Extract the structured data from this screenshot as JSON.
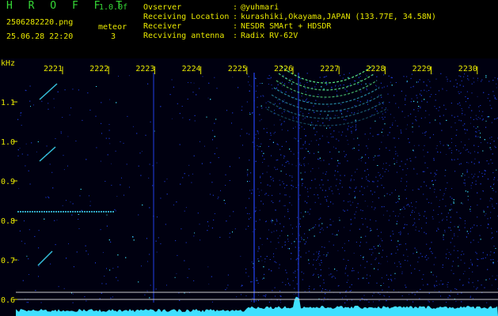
{
  "app": {
    "title": "H R O F F T",
    "version": "1.0.0f",
    "filename": "2506282220.png",
    "datetime": "25.06.28 22:20",
    "mode_label": "meteor",
    "mode_value": "3"
  },
  "info": [
    {
      "label": "Ovserver",
      "value": "@yuhmari"
    },
    {
      "label": "Receiving Location",
      "value": "kurashiki,Okayama,JAPAN (133.77E, 34.58N)"
    },
    {
      "label": "Receiver",
      "value": "NESDR SMArt + HDSDR"
    },
    {
      "label": "Recviving antenna",
      "value": "Radix RV-62V"
    }
  ],
  "separator": ":",
  "axes": {
    "y_unit": "kHz",
    "x_ticks": [
      "2221",
      "2222",
      "2223",
      "2224",
      "2225",
      "2226",
      "2227",
      "2228",
      "2229",
      "2230"
    ],
    "y_ticks": [
      "1.1",
      "1.0",
      "0.9",
      "0.8",
      "0.7",
      "0.6"
    ]
  },
  "colors": {
    "background": "#000000",
    "header_text": "#e8e800",
    "title_green": "#36d936",
    "noise_blue": "#1f3bd6",
    "signal_cyan": "#40e0ff",
    "meteor_green": "#60ff90"
  }
}
